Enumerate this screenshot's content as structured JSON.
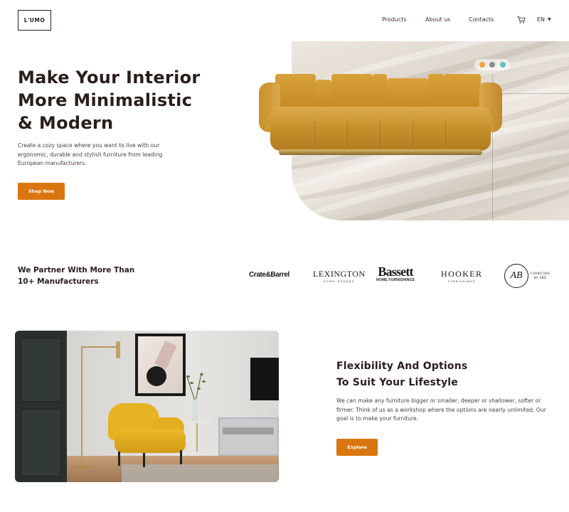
{
  "nav": {
    "logo": "L'UMO",
    "links": [
      "Products",
      "About us",
      "Contacts"
    ],
    "language": "EN"
  },
  "hero": {
    "title_lines": [
      "Make Your Interior",
      "More Minimalistic",
      "& Modern"
    ],
    "description": "Create a cozy space where you want to live with our ergonomic, durable and stylish furniture from leading European manufacturers.",
    "cta_label": "Shop Now",
    "color_swatches": [
      "#f0a43a",
      "#8a8a8a",
      "#5fc4c0"
    ]
  },
  "partners": {
    "title_lines": [
      "We Partner With More Than",
      "10+ Manufacturers"
    ],
    "brands": {
      "crate": "Crate&Barrel",
      "lexington": {
        "main": "LEXINGTON",
        "sub": "HOME BRANDS"
      },
      "bassett": {
        "main": "Bassett",
        "sub": "HOME FURNISHINGS"
      },
      "hooker": {
        "main": "HOOKER",
        "sub": "FURNISHINGS"
      },
      "ab": {
        "mark": "AB",
        "line1": "FURNITURE",
        "line2": "BY ABD"
      }
    }
  },
  "flex": {
    "title_lines": [
      "Flexibility And Options",
      "To Suit Your Lifestyle"
    ],
    "description": "We can make any furniture bigger or smaller, deeper or shallower, softer or firmer. Think of us as a workshop where the options are nearly unlimited. Our goal is to make your furniture.",
    "cta_label": "Explore"
  },
  "colors": {
    "accent": "#d9760f",
    "text_dark": "#2a1e1c"
  },
  "icons": {
    "cart": "cart-icon",
    "lang_caret": "caret-down-icon"
  }
}
